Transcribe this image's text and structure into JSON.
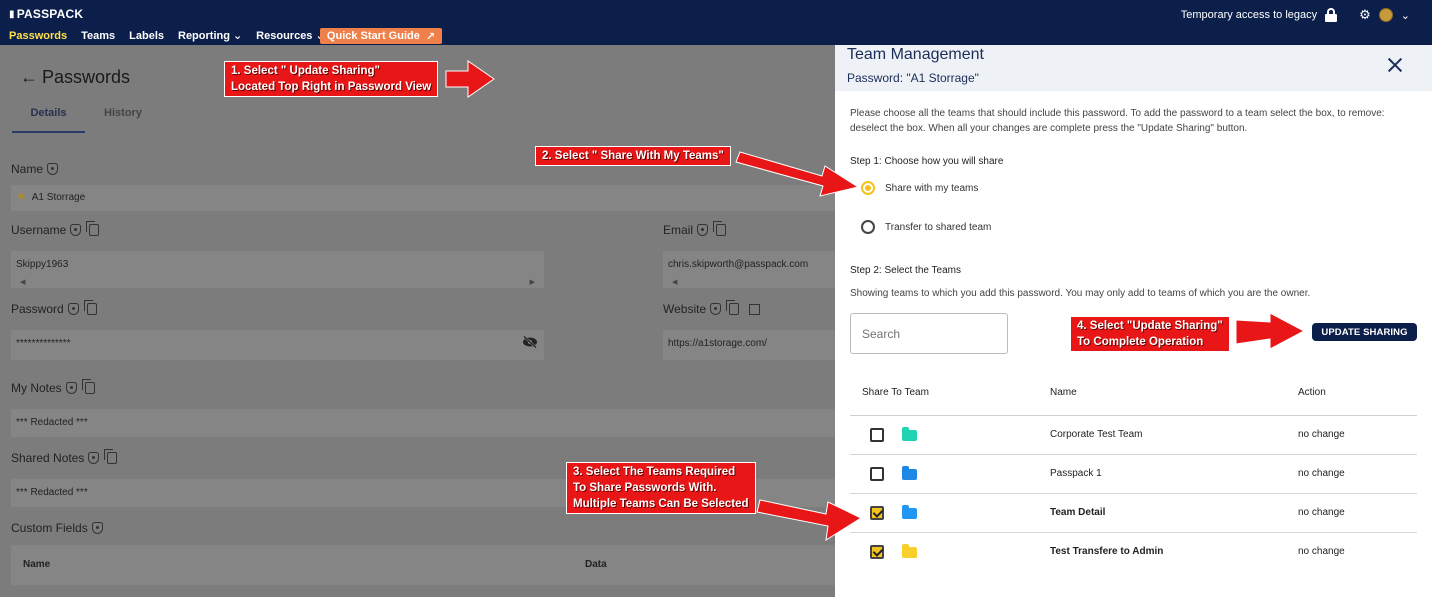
{
  "topbar": {
    "logo": "PASSPACK",
    "nav": [
      {
        "label": "Passwords",
        "active": true
      },
      {
        "label": "Teams"
      },
      {
        "label": "Labels"
      },
      {
        "label": "Reporting",
        "caret": true
      },
      {
        "label": "Resources",
        "caret": true
      }
    ],
    "quick_start": "Quick Start Guide",
    "legacy": "Temporary access to legacy"
  },
  "left": {
    "title": "Passwords",
    "tabs": [
      "Details",
      "History"
    ],
    "name_label": "Name",
    "name_value": "A1 Storrage",
    "username_label": "Username",
    "username_value": "Skippy1963",
    "email_label": "Email",
    "email_value": "chris.skipworth@passpack.com",
    "password_label": "Password",
    "password_value": "**************",
    "website_label": "Website",
    "website_value": "https://a1storage.com/",
    "notes_label": "My Notes",
    "notes_value": "*** Redacted ***",
    "shared_label": "Shared Notes",
    "shared_value": "*** Redacted ***",
    "custom_label": "Custom Fields",
    "custom_cols": [
      "Name",
      "Data"
    ]
  },
  "drawer": {
    "title": "Team Management",
    "subtitle": "Password: \"A1 Storrage\"",
    "description": "Please choose all the teams that should include this password. To add the password to a team select the box, to remove: deselect the box. When all your changes are complete press the \"Update Sharing\" button.",
    "step1": "Step 1: Choose how you will share",
    "option_share": "Share with my teams",
    "option_transfer": "Transfer to shared team",
    "step2": "Step 2: Select the Teams",
    "showing": "Showing teams to which you add this password. You may only add to teams of which you are the owner.",
    "search_placeholder": "Search",
    "update_button": "UPDATE SHARING",
    "columns": [
      "Share To Team",
      "Name",
      "Action"
    ],
    "rows": [
      {
        "name": "Corporate Test Team",
        "action": "no change",
        "checked": false,
        "folder_color": "#1fd3b3"
      },
      {
        "name": "Passpack 1",
        "action": "no change",
        "checked": false,
        "folder_color": "#1e88e5"
      },
      {
        "name": "Team Detail",
        "action": "no change",
        "checked": true,
        "folder_color": "#2196f3"
      },
      {
        "name": "Test Transfere to Admin",
        "action": "no change",
        "checked": true,
        "folder_color": "#f8d02c"
      }
    ]
  },
  "annotations": {
    "a1": [
      "1. Select \" Update Sharing\"",
      "Located Top Right in Password View"
    ],
    "a2": [
      "2. Select \" Share With My Teams\""
    ],
    "a3": [
      "3. Select The Teams Required",
      "To Share Passwords With.",
      "Multiple Teams Can Be Selected"
    ],
    "a4": [
      "4. Select \"Update Sharing\"",
      "To Complete Operation"
    ]
  },
  "colors": {
    "navbar": "#0c1f4a",
    "active_nav": "#ffe14a",
    "quick_start": "#f0804a",
    "annotation": "#e81616",
    "checkbox_on": "#f4c21c"
  }
}
